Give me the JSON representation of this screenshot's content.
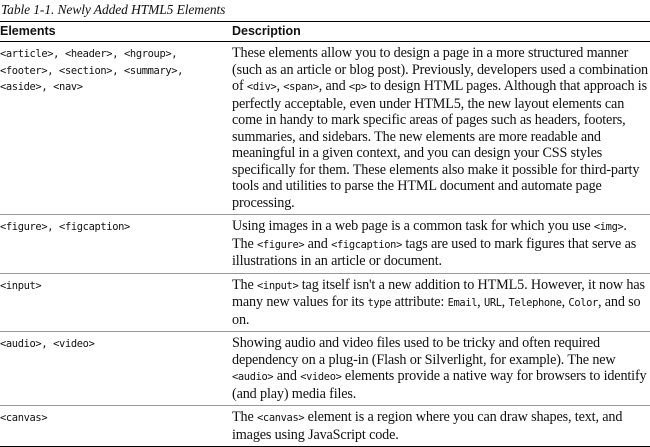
{
  "caption": "Table 1-1. Newly Added HTML5 Elements",
  "headers": {
    "elements": "Elements",
    "description": "Description"
  },
  "rows": [
    {
      "elements": "<article>, <header>, <hgroup>,\n<footer>, <section>, <summary>,\n<aside>, <nav>",
      "description": [
        {
          "t": "These elements allow you to design a page in a more structured manner (such as an article or blog post). Previously, developers used a combination of "
        },
        {
          "c": "<div>"
        },
        {
          "t": ", "
        },
        {
          "c": "<span>"
        },
        {
          "t": ", and "
        },
        {
          "c": "<p>"
        },
        {
          "t": " to design HTML pages. Although that approach is perfectly acceptable, even under HTML5, the new layout elements can come in handy to mark specific areas of pages such as headers, footers, summaries, and sidebars. The new elements are more readable and meaningful in a given context, and you can design your CSS styles specifically for them. These elements also make it possible for third-party tools and utilities to parse the HTML document and automate page processing."
        }
      ]
    },
    {
      "elements": "<figure>, <figcaption>",
      "description": [
        {
          "t": "Using images in a web page is a common task for which you use "
        },
        {
          "c": "<img>"
        },
        {
          "t": ". The "
        },
        {
          "c": "<figure>"
        },
        {
          "t": " and "
        },
        {
          "c": "<figcaption>"
        },
        {
          "t": " tags are used to mark figures that serve as illustrations in an article or document."
        }
      ]
    },
    {
      "elements": "<input>",
      "description": [
        {
          "t": "The "
        },
        {
          "c": "<input>"
        },
        {
          "t": " tag itself isn't a new addition to HTML5. However, it now has many new values for its "
        },
        {
          "c": "type"
        },
        {
          "t": " attribute: "
        },
        {
          "c": "Email"
        },
        {
          "t": ", "
        },
        {
          "c": "URL"
        },
        {
          "t": ", "
        },
        {
          "c": "Telephone"
        },
        {
          "t": ", "
        },
        {
          "c": "Color"
        },
        {
          "t": ", and so on."
        }
      ]
    },
    {
      "elements": "<audio>, <video>",
      "description": [
        {
          "t": "Showing audio and video files used to be tricky and often required dependency on a plug-in (Flash or Silverlight, for example). The new "
        },
        {
          "c": "<audio>"
        },
        {
          "t": " and "
        },
        {
          "c": "<video>"
        },
        {
          "t": " elements provide a native way for browsers to identify (and play) media files."
        }
      ]
    },
    {
      "elements": "<canvas>",
      "description": [
        {
          "t": "The "
        },
        {
          "c": "<canvas>"
        },
        {
          "t": " element is a region where you can draw shapes, text, and images using JavaScript code."
        }
      ]
    }
  ]
}
